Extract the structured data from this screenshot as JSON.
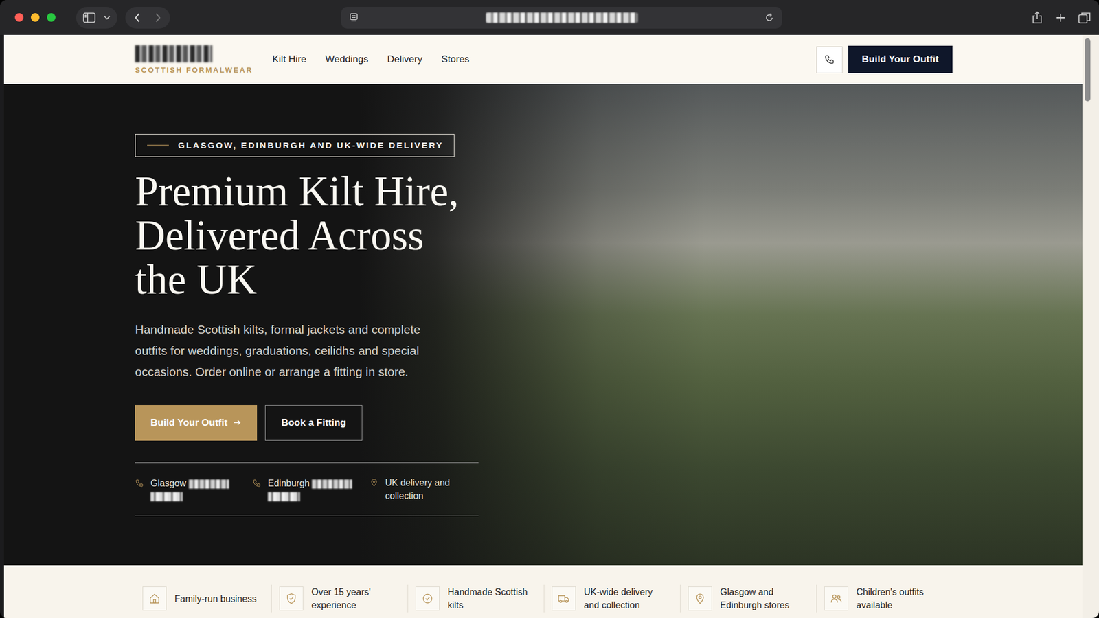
{
  "header": {
    "tagline": "SCOTTISH FORMALWEAR",
    "nav": [
      {
        "label": "Kilt Hire"
      },
      {
        "label": "Weddings"
      },
      {
        "label": "Delivery"
      },
      {
        "label": "Stores"
      }
    ],
    "cta": "Build Your Outfit"
  },
  "hero": {
    "badge": "GLASGOW, EDINBURGH AND UK-WIDE DELIVERY",
    "title_lines": [
      "Premium Kilt Hire,",
      "Delivered Across",
      "the UK"
    ],
    "description": "Handmade Scottish kilts, formal jackets and complete outfits for weddings, graduations, ceilidhs and special occasions. Order online or arrange a fitting in store.",
    "buttons": [
      {
        "label": "Build Your Outfit",
        "kind": "primary"
      },
      {
        "label": "Book a Fitting",
        "kind": "secondary"
      }
    ],
    "contacts": [
      {
        "label": "Glasgow",
        "kind": "phone"
      },
      {
        "label": "Edinburgh",
        "kind": "phone"
      },
      {
        "label": "UK delivery and collection",
        "kind": "location"
      }
    ]
  },
  "features": [
    {
      "label": "Family-run business"
    },
    {
      "label": "Over 15 years' experience"
    },
    {
      "label": "Handmade Scottish kilts"
    },
    {
      "label": "UK-wide delivery and collection"
    },
    {
      "label": "Glasgow and Edinburgh stores"
    },
    {
      "label": "Children's outfits available"
    }
  ]
}
